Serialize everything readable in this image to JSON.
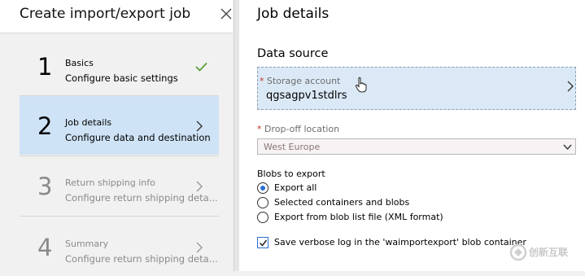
{
  "panel": {
    "title": "Create import/export job"
  },
  "steps": [
    {
      "number": "1",
      "title": "Basics",
      "subtitle": "Configure basic settings"
    },
    {
      "number": "2",
      "title": "Job details",
      "subtitle": "Configure data and destination"
    },
    {
      "number": "3",
      "title": "Return shipping info",
      "subtitle": "Configure return shipping deta..."
    },
    {
      "number": "4",
      "title": "Summary",
      "subtitle": "Configure return shipping deta..."
    }
  ],
  "details": {
    "title": "Job details",
    "data_source": "Data source",
    "storage_label": "Storage account",
    "storage_value": "qgsagpv1stdlrs",
    "dropoff_label": "Drop-off location",
    "dropoff_value": "West Europe",
    "blobs_label": "Blobs to export",
    "blob_options": [
      "Export all",
      "Selected containers and blobs",
      "Export from blob list file (XML format)"
    ],
    "verbose_label": "Save verbose log in the 'waimportexport' blob container"
  },
  "watermark": {
    "text": "创新互联"
  },
  "colors": {
    "accent": "#2b6fd6",
    "selected_step_bg": "#cfe3f6",
    "complete_check": "#5a9e3a"
  }
}
